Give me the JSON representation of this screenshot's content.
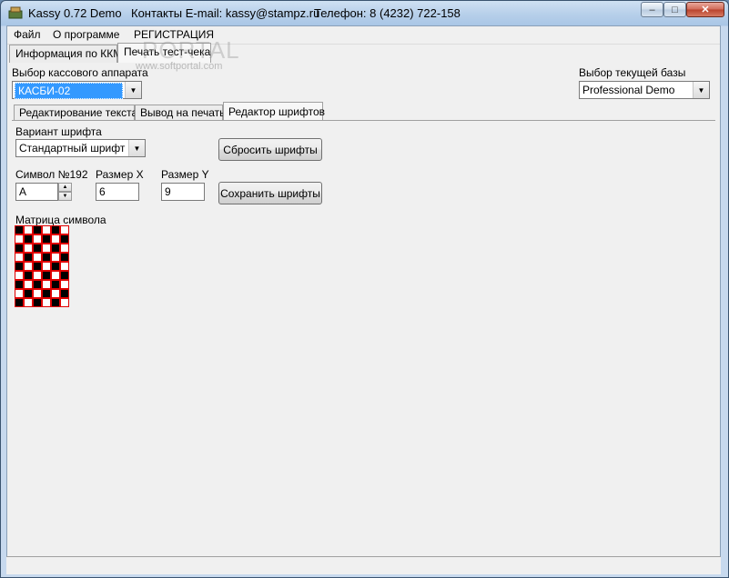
{
  "title": {
    "app": "Kassy 0.72 Demo",
    "contacts": "Контакты E-mail: kassy@stampz.ru",
    "phone": "Телефон: 8 (4232) 722-158"
  },
  "window_controls": {
    "minimize": "–",
    "maximize": "□",
    "close": "✕"
  },
  "menu": [
    "Файл",
    "О программе",
    "РЕГИСТРАЦИЯ"
  ],
  "watermark": {
    "main": "PORTAL",
    "sub": "www.softportal.com"
  },
  "top_tabs": [
    "Информация по ККМ",
    "Печать тест-чека"
  ],
  "register": {
    "label": "Выбор кассового аппарата",
    "value": "КАСБИ-02"
  },
  "database": {
    "label": "Выбор текущей базы",
    "value": "Professional Demo"
  },
  "inner_tabs": [
    "Редактирование текста",
    "Вывод на печать",
    "Редактор шрифтов"
  ],
  "font_editor": {
    "variant_label": "Вариант шрифта",
    "variant_value": "Стандартный шрифт",
    "reset_button": "Сбросить шрифты",
    "save_button": "Сохранить шрифты",
    "symbol_label": "Символ №192",
    "symbol_value": "А",
    "size_x_label": "Размер X",
    "size_x_value": "6",
    "size_y_label": "Размер Y",
    "size_y_value": "9",
    "matrix_label": "Матрица символа",
    "matrix_rows": 9,
    "matrix_cols": 6,
    "matrix_pattern": [
      [
        1,
        0,
        1,
        0,
        1,
        0
      ],
      [
        0,
        1,
        0,
        1,
        0,
        1
      ],
      [
        1,
        0,
        1,
        0,
        1,
        0
      ],
      [
        0,
        1,
        0,
        1,
        0,
        1
      ],
      [
        1,
        0,
        1,
        0,
        1,
        0
      ],
      [
        0,
        1,
        0,
        1,
        0,
        1
      ],
      [
        1,
        0,
        1,
        0,
        1,
        0
      ],
      [
        0,
        1,
        0,
        1,
        0,
        1
      ],
      [
        1,
        0,
        1,
        0,
        1,
        0
      ]
    ]
  }
}
